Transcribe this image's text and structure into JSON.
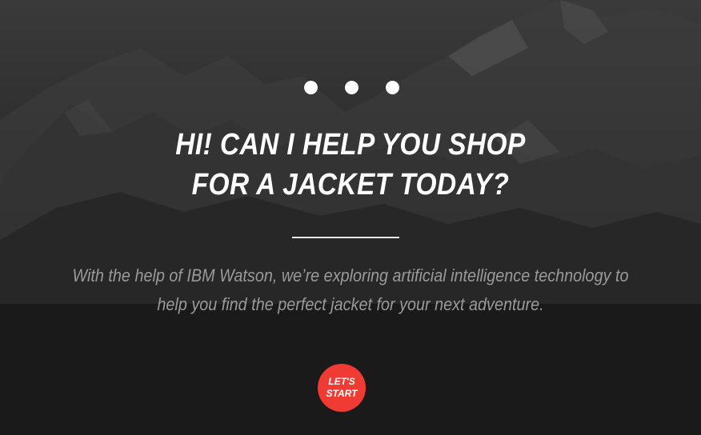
{
  "colors": {
    "background": "#2a2a2a",
    "text_primary": "#ffffff",
    "text_secondary": "#9a9a9a",
    "accent": "#ef3b33"
  },
  "progress_dots": {
    "count": 3,
    "icon": "dot-icon"
  },
  "headline": {
    "line1": "HI! CAN I HELP YOU SHOP",
    "line2": "FOR A JACKET TODAY?"
  },
  "subcopy": {
    "line1": "With the help of IBM Watson, we’re exploring artificial intelligence technology to",
    "line2": "help you find the perfect jacket for your next adventure."
  },
  "cta": {
    "line1": "LET'S",
    "line2": "START"
  },
  "background_image": {
    "icon": "mountain-landscape-image"
  }
}
